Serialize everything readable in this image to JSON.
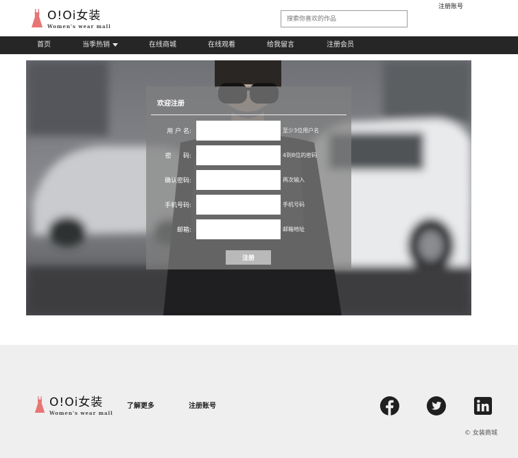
{
  "header": {
    "top_link": "注册账号",
    "logo_main": "O!Oi女装",
    "logo_sub": "Women's wear mall",
    "search_placeholder": "搜索你喜欢的作品"
  },
  "nav": {
    "items": [
      "首页",
      "当季热销",
      "在线商城",
      "在线观看",
      "给我留言",
      "注册会员"
    ]
  },
  "form": {
    "title": "欢迎注册",
    "rows": [
      {
        "label": "用 户 名:",
        "hint": "至少3位用户名"
      },
      {
        "label": "密      码:",
        "hint": "4到8位的密码"
      },
      {
        "label": "确认密码:",
        "hint": "再次输入"
      },
      {
        "label": "手机号码:",
        "hint": "手机号码"
      },
      {
        "label": "邮箱:",
        "hint": "邮箱地址"
      }
    ],
    "submit_label": "注册"
  },
  "footer": {
    "logo_main": "O!Oi女装",
    "logo_sub": "Women's wear mall",
    "links": [
      "了解更多",
      "注册账号"
    ],
    "copyright": "© 女装商城",
    "social_icons": [
      "facebook-icon",
      "twitter-icon",
      "linkedin-icon"
    ]
  },
  "colors": {
    "nav_bg": "#262626",
    "footer_bg": "#efefef",
    "dress_pink": "#e97474"
  }
}
